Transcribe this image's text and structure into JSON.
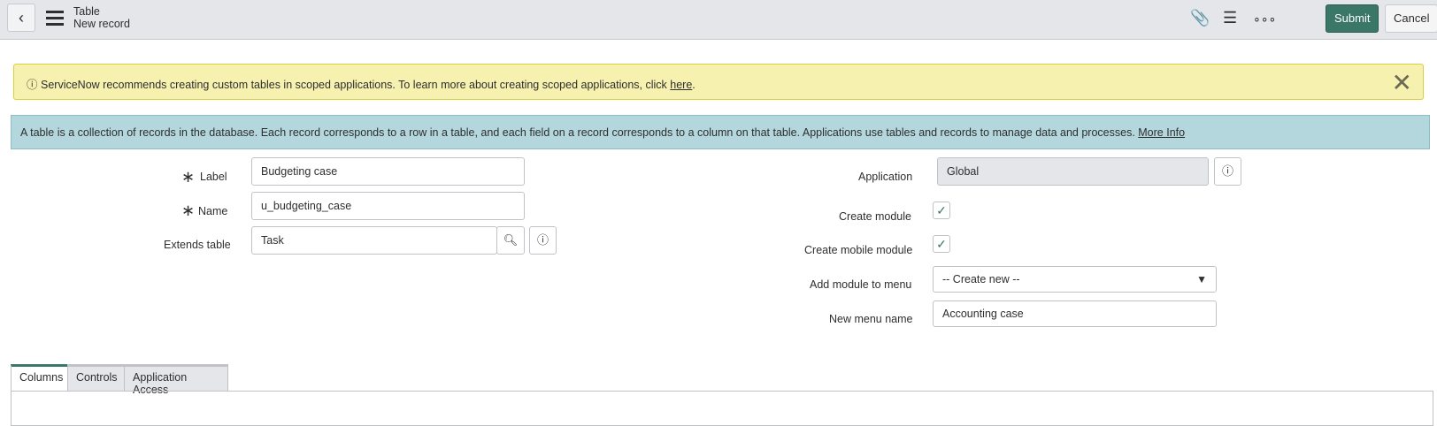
{
  "header": {
    "title": "Table",
    "subtitle": "New record",
    "submit": "Submit",
    "cancel": "Cancel"
  },
  "warning": {
    "text": "ServiceNow recommends creating custom tables in scoped applications. To learn more about creating scoped applications, click ",
    "link": "here",
    "end": "."
  },
  "info": {
    "text": "A table is a collection of records in the database. Each record corresponds to a row in a table, and each field on a record corresponds to a column on that table. Applications use tables and records to manage data and processes. ",
    "link": "More Info"
  },
  "form": {
    "label": {
      "label": "Label",
      "value": "Budgeting case"
    },
    "name": {
      "label": "Name",
      "value": "u_budgeting_case"
    },
    "extends": {
      "label": "Extends table",
      "value": "Task"
    },
    "application": {
      "label": "Application",
      "value": "Global"
    },
    "create_module": {
      "label": "Create module",
      "checked": true
    },
    "create_mobile_module": {
      "label": "Create mobile module",
      "checked": true
    },
    "add_module": {
      "label": "Add module to menu",
      "value": "-- Create new --"
    },
    "new_menu": {
      "label": "New menu name",
      "value": "Accounting case"
    }
  },
  "tabs": [
    {
      "label": "Columns"
    },
    {
      "label": "Controls"
    },
    {
      "label": "Application Access"
    }
  ]
}
